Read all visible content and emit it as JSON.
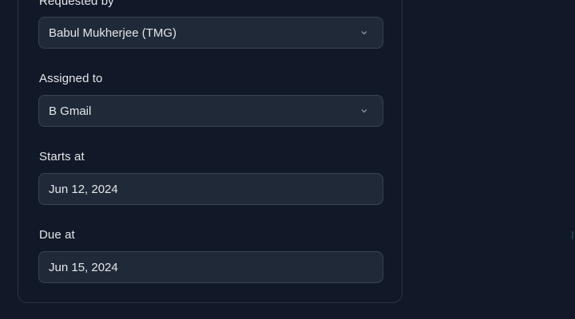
{
  "form": {
    "requested_by": {
      "label": "Requested by",
      "value": "Babul Mukherjee (TMG)",
      "icon": "chevron-down-icon"
    },
    "assigned_to": {
      "label": "Assigned to",
      "value": "B Gmail",
      "icon": "chevron-down-icon"
    },
    "starts_at": {
      "label": "Starts at",
      "value": "Jun 12, 2024"
    },
    "due_at": {
      "label": "Due at",
      "value": "Jun 15, 2024"
    }
  },
  "colors": {
    "background": "#111827",
    "field_background": "#1f2937",
    "field_border": "#3b4452",
    "text": "#e5e7eb",
    "muted": "#9ca3af"
  }
}
